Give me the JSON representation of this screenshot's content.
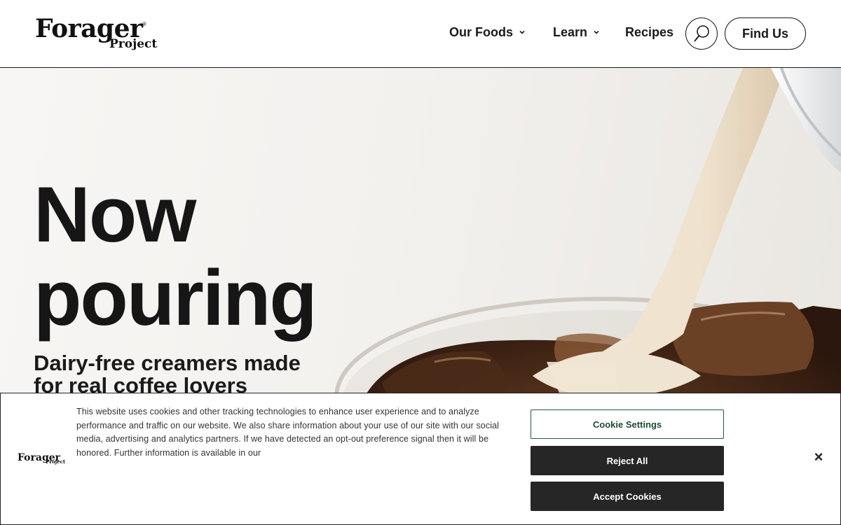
{
  "brand": {
    "logo_main": "Forager",
    "logo_sub": "Project",
    "logo_mark": "®"
  },
  "nav": {
    "items": [
      {
        "label": "Our Foods",
        "has_dropdown": true
      },
      {
        "label": "Learn",
        "has_dropdown": true
      },
      {
        "label": "Recipes",
        "has_dropdown": false
      }
    ],
    "search_icon": "search-icon",
    "cta_label": "Find Us"
  },
  "hero": {
    "title_line1": "Now",
    "title_line2": "pouring",
    "subtitle": "Dairy-free creamers made for real coffee lovers"
  },
  "cookie_banner": {
    "text": "This website uses cookies and other tracking technologies to enhance user experience and to analyze performance and traffic on our website. We also share information about your use of our site with our social media, advertising and analytics partners. If we have detected an opt-out preference signal then it will be honored. Further information is available in our",
    "settings_label": "Cookie Settings",
    "reject_label": "Reject All",
    "accept_label": "Accept Cookies",
    "close_label": "×"
  },
  "colors": {
    "text": "#1a1a1a",
    "button_dark": "#262626",
    "settings_border": "#1f5a3a",
    "hero_bg": "#f3f1ee"
  }
}
